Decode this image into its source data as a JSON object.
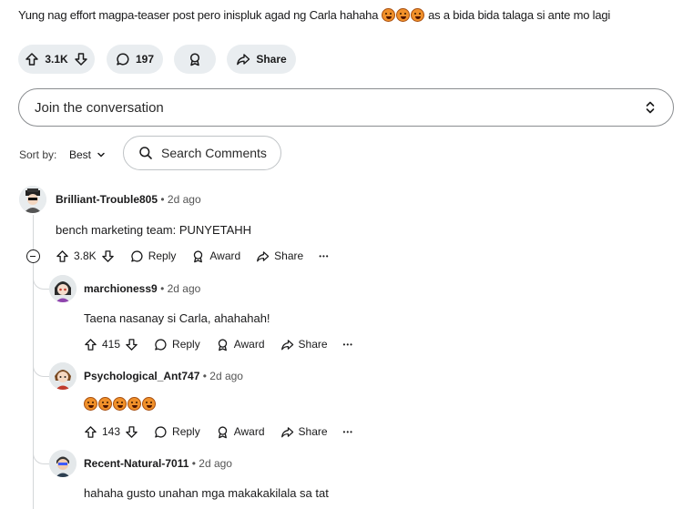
{
  "post": {
    "title_text": "Yung nag effort magpa-teaser post pero inispluk agad ng Carla hahaha",
    "title_suffix": "as a bida bida talaga si ante mo lagi",
    "vote_count": "3.1K",
    "comment_count": "197",
    "share_label": "Share"
  },
  "composer": {
    "placeholder": "Join the conversation"
  },
  "sort": {
    "label": "Sort by:",
    "value": "Best",
    "search_label": "Search Comments"
  },
  "comments": [
    {
      "author": "Brilliant-Trouble805",
      "age": "2d ago",
      "text": "bench marketing team: PUNYETAHH",
      "votes": "3.8K",
      "reply": "Reply",
      "award": "Award",
      "share": "Share",
      "more": "•••"
    },
    {
      "author": "marchioness9",
      "age": "2d ago",
      "text": "Taena nasanay si Carla, ahahahah!",
      "votes": "415",
      "reply": "Reply",
      "award": "Award",
      "share": "Share",
      "more": "•••"
    },
    {
      "author": "Psychological_Ant747",
      "age": "2d ago",
      "text": "",
      "votes": "143",
      "reply": "Reply",
      "award": "Award",
      "share": "Share",
      "more": "•••"
    },
    {
      "author": "Recent-Natural-7011",
      "age": "2d ago",
      "text": "hahaha gusto unahan mga makakakilala sa tat"
    }
  ],
  "colors": {
    "pill_bg": "#e9edf0",
    "thread_line": "#d4d7d9"
  },
  "icons": [
    "upvote-icon",
    "downvote-icon",
    "comment-icon",
    "award-icon",
    "share-icon",
    "chevron-updown-icon",
    "chevron-down-icon",
    "search-icon",
    "collapse-icon",
    "more-icon"
  ]
}
